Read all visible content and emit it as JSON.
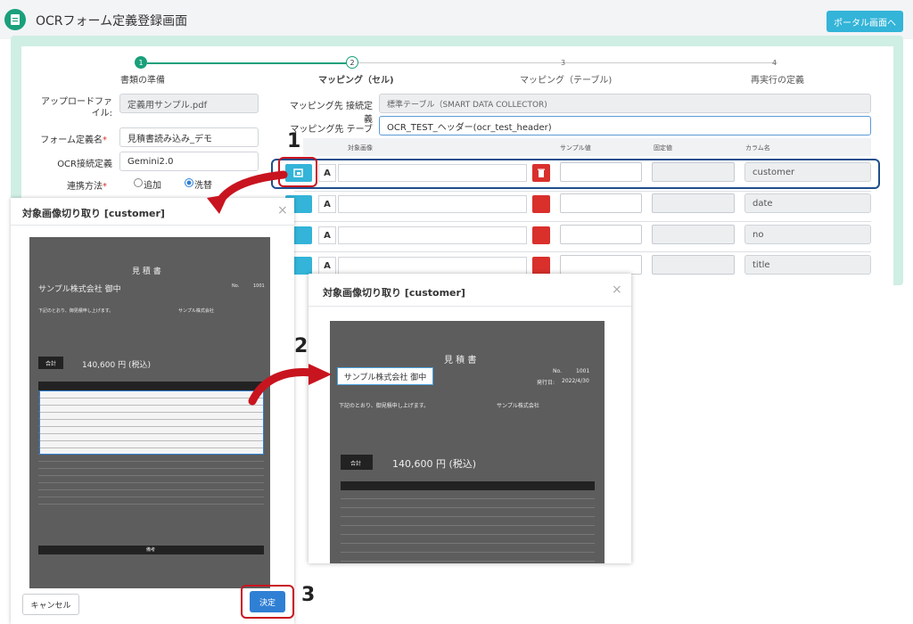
{
  "app": {
    "title": "OCRフォーム定義登録画面",
    "portal_button": "ポータル画面へ"
  },
  "stepper": [
    {
      "num": "1",
      "label": "書類の準備",
      "state": "done"
    },
    {
      "num": "2",
      "label": "マッピング（セル)",
      "state": "active"
    },
    {
      "num": "3",
      "label": "マッピング（テーブル)",
      "state": "pending"
    },
    {
      "num": "4",
      "label": "再実行の定義",
      "state": "pending"
    }
  ],
  "form": {
    "upload_label": "アップロードファイル:",
    "upload_value": "定義用サンプル.pdf",
    "form_name_label": "フォーム定義名",
    "form_name_value": "見積書読み込み_デモ",
    "ocr_conn_label": "OCR接続定義",
    "ocr_conn_value": "Gemini2.0",
    "link_method_label": "連携方法",
    "radio_add": "追加",
    "radio_replace": "洗替"
  },
  "mapping": {
    "dest_conn_label": "マッピング先 接続定義",
    "dest_conn_value": "標準テーブル（SMART DATA COLLECTOR)",
    "dest_table_label": "マッピング先 テーブル",
    "dest_table_value": "OCR_TEST_ヘッダー(ocr_test_header)",
    "columns": {
      "image": "対象画像",
      "sample": "サンプル値",
      "fixed": "固定値",
      "colname": "カラム名"
    },
    "a_label": "A",
    "rows": [
      {
        "column": "customer"
      },
      {
        "column": "date"
      },
      {
        "column": "no"
      },
      {
        "column": "title"
      }
    ]
  },
  "modal": {
    "title": "対象画像切り取り [customer]",
    "cancel": "キャンセル",
    "ok": "決定",
    "close": "×"
  },
  "document": {
    "heading": "見 積 書",
    "customer": "サンプル株式会社 御中",
    "no_label": "No.",
    "no_value": "1001",
    "date_label": "発行日:",
    "date_value": "2022/4/30",
    "greeting": "下記のとおり、御見積申し上げます。",
    "total_label": "合計",
    "total_value": "140,600 円 (税込)",
    "issuer": "サンプル株式会社",
    "table_title": "備考"
  },
  "annotations": {
    "step1": "1",
    "step2": "2",
    "step3": "3"
  },
  "colors": {
    "accent": "#33b4d8",
    "success": "#1aa07b",
    "danger": "#d9302c",
    "highlight": "#c8141f",
    "selection": "#1f4e8c"
  }
}
